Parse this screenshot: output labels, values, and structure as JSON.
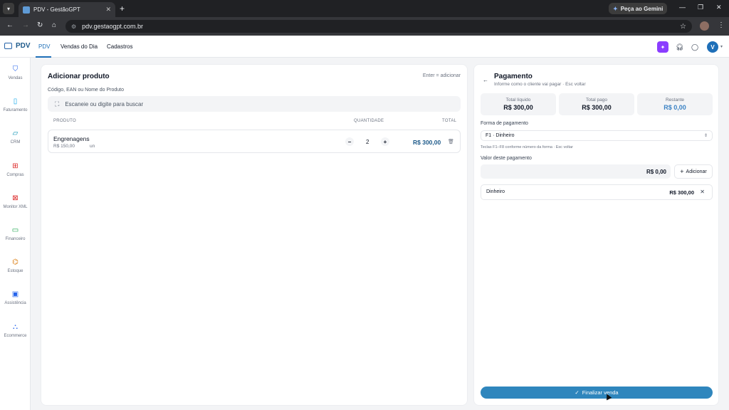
{
  "browser": {
    "tab_title": "PDV - GestãoGPT",
    "url": "pdv.gestaogpt.com.br",
    "gemini_label": "Peça ao Gemini"
  },
  "app": {
    "brand": "PDV",
    "nav": [
      "PDV",
      "Vendas do Dia",
      "Cadastros"
    ],
    "user_initial": "V"
  },
  "sidebar": {
    "items": [
      {
        "label": "Vendas",
        "icon": "basket-icon",
        "color": "#2563eb"
      },
      {
        "label": "Faturamento",
        "icon": "document-icon",
        "color": "#0ea5e9"
      },
      {
        "label": "CRM",
        "icon": "chat-icon",
        "color": "#0891b2"
      },
      {
        "label": "Compras",
        "icon": "cart-icon",
        "color": "#dc2626"
      },
      {
        "label": "Monitor XML",
        "icon": "file-x-icon",
        "color": "#dc2626"
      },
      {
        "label": "Financeiro",
        "icon": "money-icon",
        "color": "#16a34a"
      },
      {
        "label": "Estoque",
        "icon": "boxes-icon",
        "color": "#d97706"
      },
      {
        "label": "Assistência",
        "icon": "calendar-icon",
        "color": "#2563eb"
      },
      {
        "label": "Ecommerce",
        "icon": "bag-icon",
        "color": "#2563eb"
      }
    ]
  },
  "add_product": {
    "title": "Adicionar produto",
    "hint": "Enter = adicionar",
    "search_label": "Código, EAN ou Nome do Produto",
    "search_placeholder": "Escaneie ou digite para buscar",
    "columns": {
      "product": "PRODUTO",
      "quantity": "QUANTIDADE",
      "total": "TOTAL"
    },
    "items": [
      {
        "name": "Engrenagens",
        "unit_price": "R$ 150,00",
        "unit": "un",
        "quantity": "2",
        "total": "R$ 300,00"
      }
    ]
  },
  "payment": {
    "title": "Pagamento",
    "subtitle": "Informe como o cliente vai pagar · Esc voltar",
    "cards": [
      {
        "label": "Total líquido",
        "value": "R$ 300,00"
      },
      {
        "label": "Total pago",
        "value": "R$ 300,00"
      },
      {
        "label": "Restante",
        "value": "R$ 0,00"
      }
    ],
    "method_label": "Forma de pagamento",
    "method_selected": "F1 · Dinheiro",
    "key_hint": "Teclas F1–F8 conforme número da forma · Esc voltar",
    "amount_label": "Valor deste pagamento",
    "amount_value": "R$ 0,00",
    "add_label": "Adicionar",
    "entries": [
      {
        "method": "Dinheiro",
        "value": "R$ 300,00"
      }
    ],
    "finalize_label": "Finalizar venda"
  }
}
